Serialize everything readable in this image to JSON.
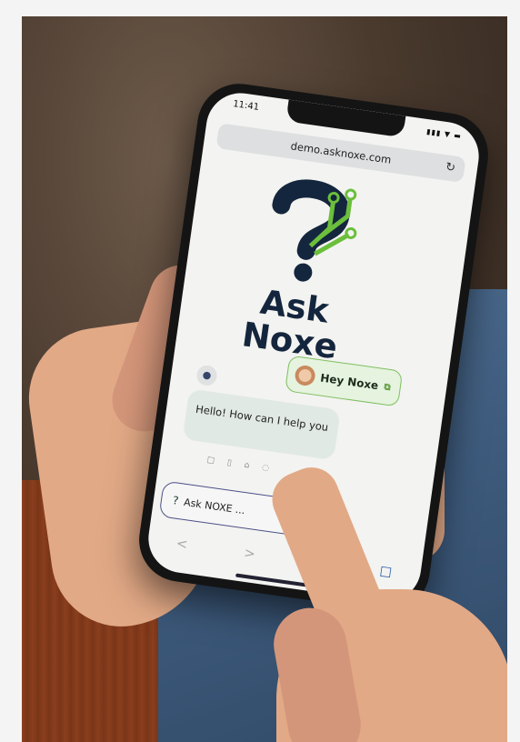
{
  "status_bar": {
    "time": "11:41",
    "icons": "▮▮▮ ▼ ▬"
  },
  "browser": {
    "url": "demo.asknoxe.com",
    "reload_icon": "reload-icon"
  },
  "brand": {
    "line1": "Ask",
    "line2": "Noxe",
    "colors": {
      "dark": "#14263d",
      "green": "#6bbf3c"
    }
  },
  "hey_button": {
    "label": "Hey Noxe",
    "edit_icon": "⧉"
  },
  "chat": {
    "greeting": "Hello! How can I help you",
    "action_icons": [
      "□",
      "▯",
      "⌂",
      "◌"
    ]
  },
  "ask_input": {
    "placeholder": "Ask NOXE ..."
  },
  "bottom_nav": {
    "back": "<",
    "forward": ">",
    "share": "⇧",
    "bookmarks": "☐"
  }
}
